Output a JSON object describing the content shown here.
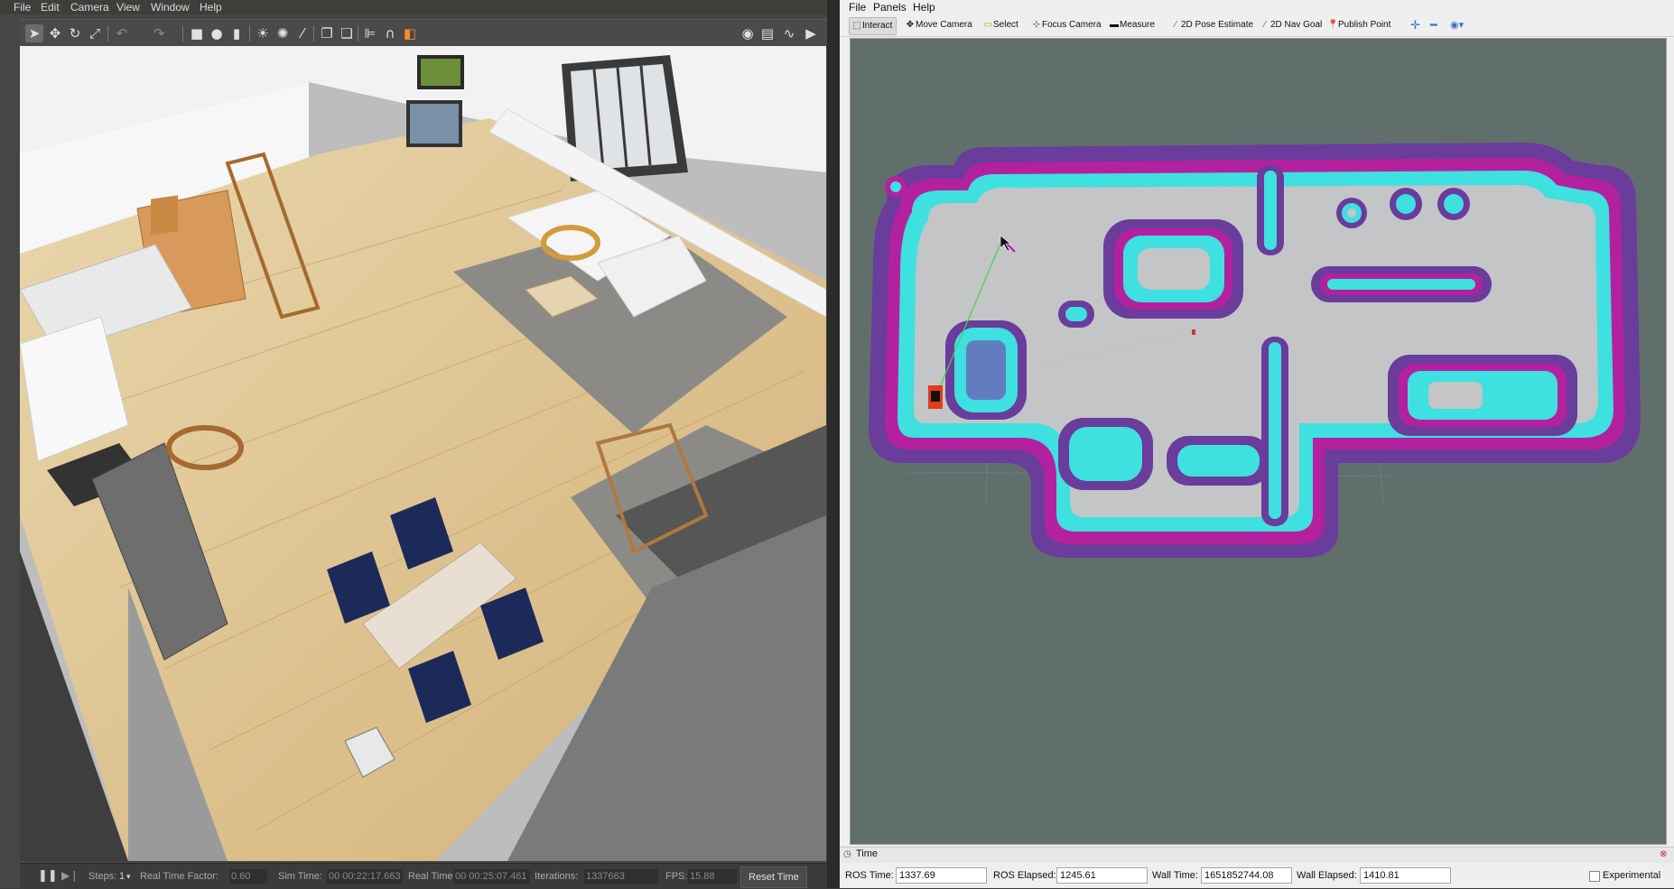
{
  "gazebo": {
    "menu": [
      "File",
      "Edit",
      "Camera",
      "View",
      "Window",
      "Help"
    ],
    "status": {
      "steps_label": "Steps:",
      "steps_value": "1",
      "rtf_label": "Real Time Factor:",
      "rtf_value": "0.60",
      "sim_time_label": "Sim Time:",
      "sim_time_value": "00 00:22:17.663",
      "real_time_label": "Real Time:",
      "real_time_value": "00 00:25:07.461",
      "iterations_label": "Iterations:",
      "iterations_value": "1337663",
      "fps_label": "FPS:",
      "fps_value": "15.88",
      "reset_label": "Reset Time"
    }
  },
  "rviz": {
    "menu": [
      "File",
      "Panels",
      "Help"
    ],
    "tools": {
      "interact": "Interact",
      "move_camera": "Move Camera",
      "select": "Select",
      "focus_camera": "Focus Camera",
      "measure": "Measure",
      "pose_estimate": "2D Pose Estimate",
      "nav_goal": "2D Nav Goal",
      "publish_point": "Publish Point"
    },
    "time_panel": {
      "title": "Time",
      "ros_time_label": "ROS Time:",
      "ros_time_value": "1337.69",
      "ros_elapsed_label": "ROS Elapsed:",
      "ros_elapsed_value": "1245.61",
      "wall_time_label": "Wall Time:",
      "wall_time_value": "1651852744.08",
      "wall_elapsed_label": "Wall Elapsed:",
      "wall_elapsed_value": "1410.81",
      "experimental_label": "Experimental"
    }
  },
  "colors": {
    "costmap_outer": "#6a3c9c",
    "costmap_mid": "#b0209f",
    "costmap_inner": "#3de0e0",
    "rviz_background": "#616f6c",
    "free_space": "#c4c5c6"
  }
}
